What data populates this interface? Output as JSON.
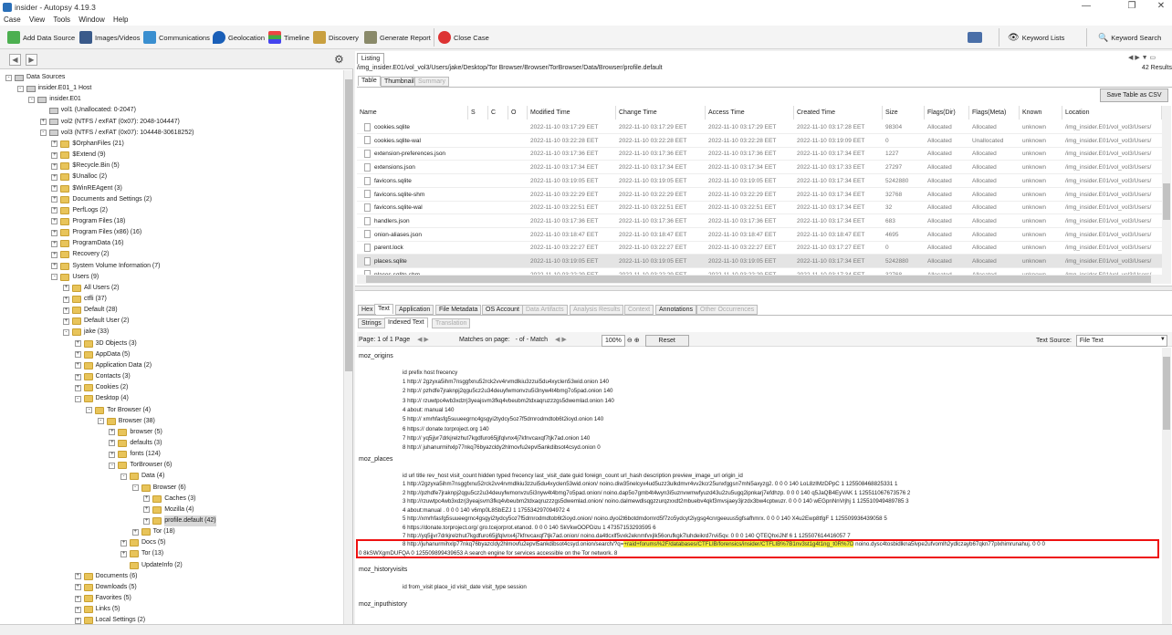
{
  "window": {
    "title": "insider - Autopsy 4.19.3",
    "min": "—",
    "max": "❐",
    "close": "✕"
  },
  "menu": [
    "Case",
    "View",
    "Tools",
    "Window",
    "Help"
  ],
  "toolbar": {
    "add_data_source": "Add Data Source",
    "images_videos": "Images/Videos",
    "communications": "Communications",
    "geolocation": "Geolocation",
    "timeline": "Timeline",
    "discovery": "Discovery",
    "generate_report": "Generate Report",
    "close_case": "Close Case",
    "keyword_lists": "Keyword Lists",
    "keyword_search": "Keyword Search"
  },
  "tree": [
    {
      "label": "Data Sources",
      "level": 0,
      "tog": "-",
      "icon": "disk"
    },
    {
      "label": "insider.E01_1 Host",
      "level": 1,
      "tog": "-",
      "icon": "disk"
    },
    {
      "label": "insider.E01",
      "level": 2,
      "tog": "-",
      "icon": "disk"
    },
    {
      "label": "vol1 (Unallocated: 0-2047)",
      "level": 3,
      "tog": "",
      "icon": "disk"
    },
    {
      "label": "vol2 (NTFS / exFAT (0x07): 2048-104447)",
      "level": 3,
      "tog": "+",
      "icon": "disk"
    },
    {
      "label": "vol3 (NTFS / exFAT (0x07): 104448-30618252)",
      "level": 3,
      "tog": "-",
      "icon": "disk"
    },
    {
      "label": "$OrphanFiles (21)",
      "level": 4,
      "tog": "+",
      "icon": "fold"
    },
    {
      "label": "$Extend (9)",
      "level": 4,
      "tog": "+",
      "icon": "fold"
    },
    {
      "label": "$Recycle.Bin (5)",
      "level": 4,
      "tog": "+",
      "icon": "fold"
    },
    {
      "label": "$Unalloc (2)",
      "level": 4,
      "tog": "+",
      "icon": "fold"
    },
    {
      "label": "$WinREAgent (3)",
      "level": 4,
      "tog": "+",
      "icon": "fold"
    },
    {
      "label": "Documents and Settings (2)",
      "level": 4,
      "tog": "+",
      "icon": "fold"
    },
    {
      "label": "PerfLogs (2)",
      "level": 4,
      "tog": "+",
      "icon": "fold"
    },
    {
      "label": "Program Files (18)",
      "level": 4,
      "tog": "+",
      "icon": "fold"
    },
    {
      "label": "Program Files (x86) (16)",
      "level": 4,
      "tog": "+",
      "icon": "fold"
    },
    {
      "label": "ProgramData (16)",
      "level": 4,
      "tog": "+",
      "icon": "fold"
    },
    {
      "label": "Recovery (2)",
      "level": 4,
      "tog": "+",
      "icon": "fold"
    },
    {
      "label": "System Volume Information (7)",
      "level": 4,
      "tog": "+",
      "icon": "fold"
    },
    {
      "label": "Users (9)",
      "level": 4,
      "tog": "-",
      "icon": "fold"
    },
    {
      "label": "All Users (2)",
      "level": 5,
      "tog": "+",
      "icon": "fold"
    },
    {
      "label": "ctfli (37)",
      "level": 5,
      "tog": "+",
      "icon": "fold"
    },
    {
      "label": "Default (28)",
      "level": 5,
      "tog": "+",
      "icon": "fold"
    },
    {
      "label": "Default User (2)",
      "level": 5,
      "tog": "+",
      "icon": "fold"
    },
    {
      "label": "jake (33)",
      "level": 5,
      "tog": "-",
      "icon": "fold"
    },
    {
      "label": "3D Objects (3)",
      "level": 6,
      "tog": "+",
      "icon": "fold"
    },
    {
      "label": "AppData (5)",
      "level": 6,
      "tog": "+",
      "icon": "fold"
    },
    {
      "label": "Application Data (2)",
      "level": 6,
      "tog": "+",
      "icon": "fold"
    },
    {
      "label": "Contacts (3)",
      "level": 6,
      "tog": "+",
      "icon": "fold"
    },
    {
      "label": "Cookies (2)",
      "level": 6,
      "tog": "+",
      "icon": "fold"
    },
    {
      "label": "Desktop (4)",
      "level": 6,
      "tog": "-",
      "icon": "fold"
    },
    {
      "label": "Tor Browser (4)",
      "level": 7,
      "tog": "-",
      "icon": "fold"
    },
    {
      "label": "Browser (38)",
      "level": 8,
      "tog": "-",
      "icon": "fold"
    },
    {
      "label": "browser (5)",
      "level": 9,
      "tog": "+",
      "icon": "fold"
    },
    {
      "label": "defaults (3)",
      "level": 9,
      "tog": "+",
      "icon": "fold"
    },
    {
      "label": "fonts (124)",
      "level": 9,
      "tog": "+",
      "icon": "fold"
    },
    {
      "label": "TorBrowser (6)",
      "level": 9,
      "tog": "-",
      "icon": "fold"
    },
    {
      "label": "Data (4)",
      "level": 10,
      "tog": "-",
      "icon": "fold"
    },
    {
      "label": "Browser (6)",
      "level": 11,
      "tog": "-",
      "icon": "fold"
    },
    {
      "label": "Caches (3)",
      "level": 12,
      "tog": "+",
      "icon": "fold"
    },
    {
      "label": "Mozilla (4)",
      "level": 12,
      "tog": "+",
      "icon": "fold"
    },
    {
      "label": "profile.default (42)",
      "level": 12,
      "tog": "+",
      "icon": "fold",
      "selected": true
    },
    {
      "label": "Tor (18)",
      "level": 11,
      "tog": "+",
      "icon": "fold"
    },
    {
      "label": "Docs (5)",
      "level": 10,
      "tog": "+",
      "icon": "fold"
    },
    {
      "label": "Tor (13)",
      "level": 10,
      "tog": "+",
      "icon": "fold"
    },
    {
      "label": "UpdateInfo (2)",
      "level": 10,
      "tog": "",
      "icon": "fold"
    },
    {
      "label": "Documents (6)",
      "level": 6,
      "tog": "+",
      "icon": "fold"
    },
    {
      "label": "Downloads (5)",
      "level": 6,
      "tog": "+",
      "icon": "fold"
    },
    {
      "label": "Favorites (5)",
      "level": 6,
      "tog": "+",
      "icon": "fold"
    },
    {
      "label": "Links (5)",
      "level": 6,
      "tog": "+",
      "icon": "fold"
    },
    {
      "label": "Local Settings (2)",
      "level": 6,
      "tog": "+",
      "icon": "fold"
    }
  ],
  "listing": {
    "tab": "Listing",
    "path": "/img_insider.E01/vol_vol3/Users/jake/Desktop/Tor Browser/Browser/TorBrowser/Data/Browser/profile.default",
    "count": "42 Results",
    "view_tabs": [
      "Table",
      "Thumbnail",
      "Summary"
    ],
    "save_button": "Save Table as CSV",
    "columns": [
      "Name",
      "S",
      "C",
      "O",
      "Modified Time",
      "Change Time",
      "Access Time",
      "Created Time",
      "Size",
      "Flags(Dir)",
      "Flags(Meta)",
      "Known",
      "Location"
    ],
    "rows": [
      [
        "cookies.sqlite",
        "2022-11-10 03:17:29 EET",
        "2022-11-10 03:17:29 EET",
        "2022-11-10 03:17:29 EET",
        "2022-11-10 03:17:28 EET",
        "98304",
        "Allocated",
        "Allocated",
        "unknown",
        "/img_insider.E01/vol_vol3/Users/"
      ],
      [
        "cookies.sqlite-wal",
        "2022-11-10 03:22:28 EET",
        "2022-11-10 03:22:28 EET",
        "2022-11-10 03:22:28 EET",
        "2022-11-10 03:19:09 EET",
        "0",
        "Allocated",
        "Unallocated",
        "unknown",
        "/img_insider.E01/vol_vol3/Users/"
      ],
      [
        "extension-preferences.json",
        "2022-11-10 03:17:36 EET",
        "2022-11-10 03:17:36 EET",
        "2022-11-10 03:17:36 EET",
        "2022-11-10 03:17:34 EET",
        "1227",
        "Allocated",
        "Allocated",
        "unknown",
        "/img_insider.E01/vol_vol3/Users/"
      ],
      [
        "extensions.json",
        "2022-11-10 03:17:34 EET",
        "2022-11-10 03:17:34 EET",
        "2022-11-10 03:17:34 EET",
        "2022-11-10 03:17:33 EET",
        "27297",
        "Allocated",
        "Allocated",
        "unknown",
        "/img_insider.E01/vol_vol3/Users/"
      ],
      [
        "favicons.sqlite",
        "2022-11-10 03:19:05 EET",
        "2022-11-10 03:19:05 EET",
        "2022-11-10 03:19:05 EET",
        "2022-11-10 03:17:34 EET",
        "5242880",
        "Allocated",
        "Allocated",
        "unknown",
        "/img_insider.E01/vol_vol3/Users/"
      ],
      [
        "favicons.sqlite-shm",
        "2022-11-10 03:22:29 EET",
        "2022-11-10 03:22:29 EET",
        "2022-11-10 03:22:29 EET",
        "2022-11-10 03:17:34 EET",
        "32768",
        "Allocated",
        "Allocated",
        "unknown",
        "/img_insider.E01/vol_vol3/Users/"
      ],
      [
        "favicons.sqlite-wal",
        "2022-11-10 03:22:51 EET",
        "2022-11-10 03:22:51 EET",
        "2022-11-10 03:22:51 EET",
        "2022-11-10 03:17:34 EET",
        "32",
        "Allocated",
        "Allocated",
        "unknown",
        "/img_insider.E01/vol_vol3/Users/"
      ],
      [
        "handlers.json",
        "2022-11-10 03:17:36 EET",
        "2022-11-10 03:17:36 EET",
        "2022-11-10 03:17:36 EET",
        "2022-11-10 03:17:34 EET",
        "683",
        "Allocated",
        "Allocated",
        "unknown",
        "/img_insider.E01/vol_vol3/Users/"
      ],
      [
        "onion-aliases.json",
        "2022-11-10 03:18:47 EET",
        "2022-11-10 03:18:47 EET",
        "2022-11-10 03:18:47 EET",
        "2022-11-10 03:18:47 EET",
        "4695",
        "Allocated",
        "Allocated",
        "unknown",
        "/img_insider.E01/vol_vol3/Users/"
      ],
      [
        "parent.lock",
        "2022-11-10 03:22:27 EET",
        "2022-11-10 03:22:27 EET",
        "2022-11-10 03:22:27 EET",
        "2022-11-10 03:17:27 EET",
        "0",
        "Allocated",
        "Allocated",
        "unknown",
        "/img_insider.E01/vol_vol3/Users/"
      ],
      [
        "places.sqlite",
        "2022-11-10 03:19:05 EET",
        "2022-11-10 03:19:05 EET",
        "2022-11-10 03:19:05 EET",
        "2022-11-10 03:17:34 EET",
        "5242880",
        "Allocated",
        "Allocated",
        "unknown",
        "/img_insider.E01/vol_vol3/Users/"
      ],
      [
        "places.sqlite-shm",
        "2022-11-10 03:22:29 EET",
        "2022-11-10 03:22:29 EET",
        "2022-11-10 03:22:29 EET",
        "2022-11-10 03:17:34 EET",
        "32768",
        "Allocated",
        "Allocated",
        "unknown",
        "/img_insider.E01/vol_vol3/Users/"
      ]
    ]
  },
  "content_tabs": [
    "Hex",
    "Text",
    "Application",
    "File Metadata",
    "OS Account",
    "Data Artifacts",
    "Analysis Results",
    "Context",
    "Annotations",
    "Other Occurrences"
  ],
  "text_subtabs": [
    "Strings",
    "Indexed Text",
    "Translation"
  ],
  "text_controls": {
    "page_label": "Page:",
    "page_value": "1",
    "page_of": "of",
    "page_total": "1",
    "page_word": "Page",
    "matches_label": "Matches on page:",
    "matches_value": "-",
    "matches_of": "of",
    "matches_total": "-",
    "match_word": "Match",
    "zoom": "100%",
    "reset": "Reset",
    "text_source_label": "Text Source:",
    "text_source_value": "File Text"
  },
  "text_content": {
    "moz_origins": "moz_origins",
    "origins_header": "id prefix host frecency",
    "origins": [
      "1 http:// 2gzyxa5ihm7nsggfxnu52rck2vv4rvmdlkiu3zzui5du4xyclen53wid.onion 140",
      "2 http:// pzhdfe7jraknpj2qgu5cz2u34deuyfwmonvzu5i3nyw4t4bmg7o5pad.onion 140",
      "3 http:// rzuwtpc4wb3xdzrj3yeajsvm3fkq4vbeubm2tdxaqruzzzgs5dwemlad.onion 140",
      "4 about: manual 140",
      "5 http:// xmrhfasfg5suueegrnc4gsgyi2tydcy5oz7f5drnrodmdtob6t2ioyd.onion 140",
      "6 https:// donate.torproject.org 140",
      "7 http:// yq5jjvr7drkjrelzhut7kgdfuro65jjfqlvnx4j7kfnvcaxqf7tjk7ad.onion 140",
      "8 http:// juhanurmihxlp77nkq76byazcldy2hlmovfu2epvl5ankdibsot4csyd.onion 0"
    ],
    "moz_places": "moz_places",
    "places_header": "id url title rev_host visit_count hidden typed frecency last_visit_date guid foreign_count url_hash description preview_image_url origin_id",
    "places": [
      "1 http://2gzyxa5ihm7nsggfxnu52rck2vv4rvmdlkiu3zzui5du4xyclen53wid.onion/ noino.diw35nelcyx4ud5uzz3ulkdmvr4vv2kcr25unxfggsn7mhi5axyzg2. 0 0 0 140 LoL8zIMzDPpC 1 125508468825331 1",
      "2 http://pzhdfe7jraknpj2qgu5cz2u34deuyfwmonvzu5i3nyw4t4bmg7o5pad.onion/ noino.dap5o7gmb4t4wyn3i5uznvwmwfyuzd43u2zu5ugq2ipnkarj7efdhzp. 0 0 0 140 q5JaQB4EyVAK 1 125511067673576 2",
      "3 http://rzuwtpc4wb3xdzrj3yeajsvm3fkq4vbeubm2tdxaqruzzzgs5dwemlad.onion/ noino.dalmewdlsqgzzurqzxxdt2mbuebv4qkf3mvsjaey3jrzdx3bw4cptwuzr. 0 0 0 140 wEGpnNnVrjhj 1 125510949489785 3",
      "4 about:manual . 0 0 0 140 v6mp0L8SbEZJ 1 175534297094972 4",
      "5 http://xmrhfasfg5suueegrnc4gsgyi2tydcy5oz7f5drnrodmdtob6t2ioyd.onion/ noino.dyoi2t6botdmdornrd5f7zo5ydcyt2iygsg4cnrgeeuus5gfsafhmrx. 0 0 0 140 X4u2Ewp8tfgF 1 125509936439058 5",
      "6 https://donate.torproject.org/ gro.tcejorprot.etanod. 0 0 0 140 SkVkwOOPDizu 1 47357153293595 6",
      "7 http://yq5jjvr7drkjrelzhut7kgdfuro65jjfqlvnx4j7kfnvcaxqf7tjk7ad.onion/ noino.da4tlcxlf5vxk2eknmfvxjlk56orufkgk7luhdeikrd7rvii5qv. 0 0 0 140 QTEQhxiJNf 6 1 125507614416057 7",
      "8 http://juhanurmihxlp77nkq76byazcldy2hlmovfu2epvl5ankdibsot4csyd.onion/search/?q="
    ],
    "place8_highlight": "+raid+forums%2F/databases/CTFLIB/forensics/insider/CTFLIB%7B1nv3st1g4t1ng_t0R%7D",
    "place8_tail": " noino.dysc4tosbidlkna5lvpe2ufvomlh2ydlczayb67qkn77plxhimrunahuj. 0 0 0",
    "place8_line2": "0 8kSWXgmDUFQA 0 125509899439653 A search engine for services accessible on the Tor network.  8",
    "moz_historyvisits": "moz_historyvisits",
    "historyvisits_header": "id from_visit place_id visit_date visit_type session",
    "moz_inputhistory": "moz_inputhistory"
  }
}
